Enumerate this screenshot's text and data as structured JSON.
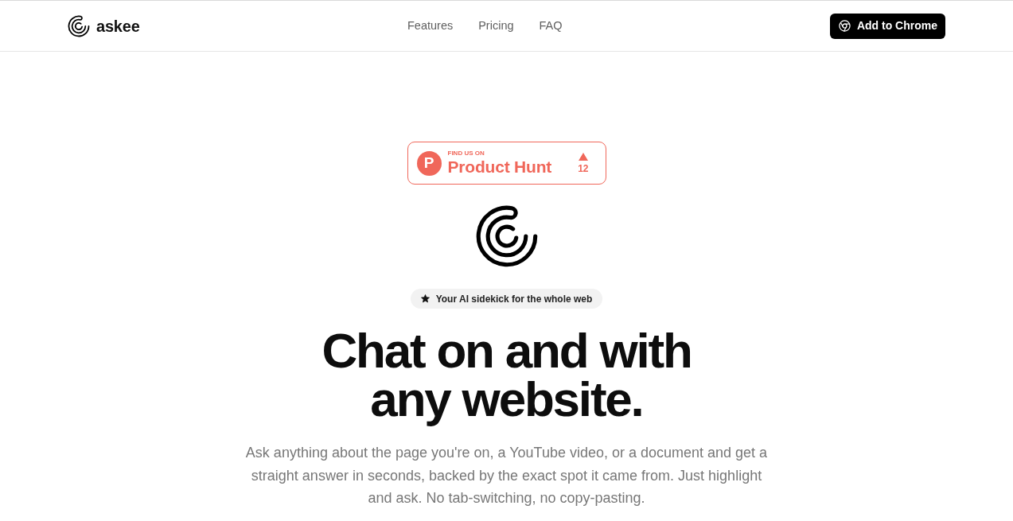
{
  "navbar": {
    "brand": "askee",
    "links": [
      {
        "label": "Features"
      },
      {
        "label": "Pricing"
      },
      {
        "label": "FAQ"
      }
    ],
    "cta": "Add to Chrome"
  },
  "hero": {
    "product_hunt_badge": {
      "logo_letter": "P",
      "kicker": "FIND US ON",
      "name": "Product Hunt",
      "upvotes": "12"
    },
    "tagline": "Your AI sidekick for the whole web",
    "heading": "Chat on and with any website.",
    "description": "Ask anything about the page you're on, a YouTube video, or a document and get a straight answer in seconds, backed by the exact spot it came from. Just highlight and ask. No tab-switching, no copy-pasting."
  }
}
